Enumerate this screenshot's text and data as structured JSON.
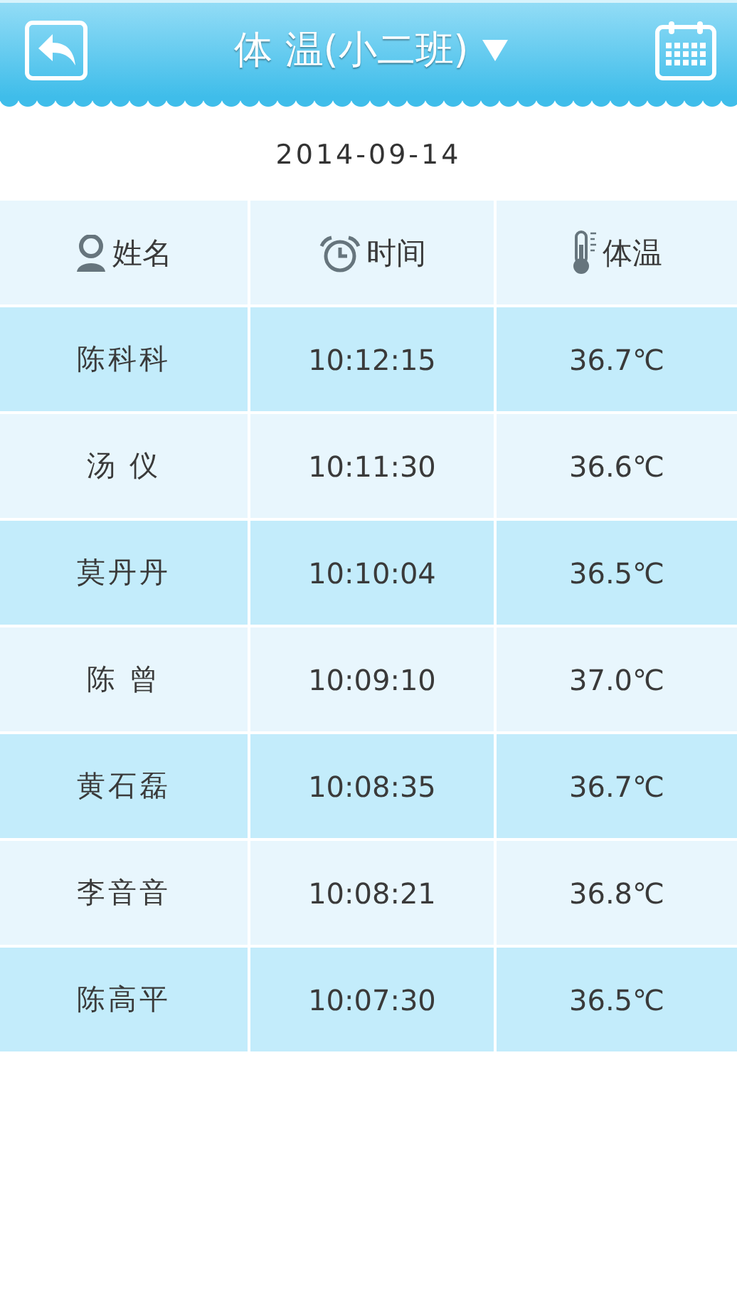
{
  "header": {
    "title": "体 温(小二班)"
  },
  "date": "2014-09-14",
  "table": {
    "columns": [
      "姓名",
      "时间",
      "体温"
    ],
    "rows": [
      {
        "name": "陈科科",
        "time": "10:12:15",
        "temp": "36.7℃"
      },
      {
        "name": "汤 仪",
        "time": "10:11:30",
        "temp": "36.6℃"
      },
      {
        "name": "莫丹丹",
        "time": "10:10:04",
        "temp": "36.5℃"
      },
      {
        "name": "陈 曾",
        "time": "10:09:10",
        "temp": "37.0℃"
      },
      {
        "name": "黄石磊",
        "time": "10:08:35",
        "temp": "36.7℃"
      },
      {
        "name": "李音音",
        "time": "10:08:21",
        "temp": "36.8℃"
      },
      {
        "name": "陈高平",
        "time": "10:07:30",
        "temp": "36.5℃"
      }
    ]
  }
}
